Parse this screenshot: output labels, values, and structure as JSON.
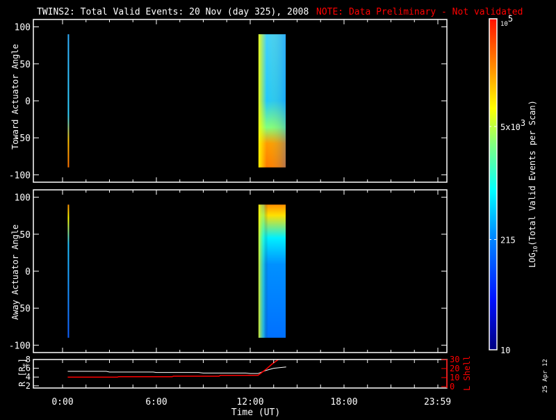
{
  "title": "TWINS2: Total Valid Events: 20 Nov (day 325), 2008",
  "note": "NOTE: Data Preliminary - Not validated",
  "datestamp": "25 Apr 12",
  "colors": {
    "background": "#000000",
    "axes": "#ffffff",
    "note": "#ff0000",
    "lshell": "#ff0000",
    "r": "#ffffff"
  },
  "chart_data": [
    {
      "type": "heatmap",
      "ylabel": "Toward Actuator Angle",
      "ylim": [
        -110,
        110
      ],
      "yticks": [
        "100",
        "50",
        "0",
        "-50",
        "-100"
      ],
      "xlim_hours": [
        0,
        24
      ],
      "intervals": [
        {
          "start_h": 0.33,
          "end_h": 0.42,
          "angle_range": [
            -90,
            90
          ],
          "description_colors": [
            "#ff7000",
            "#30c0ff",
            "#30c0ff",
            "#20a0ff"
          ]
        },
        {
          "start_h": 12.53,
          "end_h": 14.27,
          "angle_range": [
            -90,
            90
          ]
        }
      ]
    },
    {
      "type": "heatmap",
      "ylabel": "Away Actuator Angle",
      "ylim": [
        -110,
        110
      ],
      "yticks": [
        "100",
        "50",
        "0",
        "-50",
        "-100"
      ],
      "xlim_hours": [
        0,
        24
      ],
      "intervals": [
        {
          "start_h": 0.33,
          "end_h": 0.42,
          "angle_range": [
            -90,
            90
          ]
        },
        {
          "start_h": 12.53,
          "end_h": 14.27,
          "angle_range": [
            -90,
            90
          ]
        }
      ]
    },
    {
      "type": "line",
      "ylabel": "R [R",
      "ylabel_sub": "E",
      "ylim": [
        1.5,
        8
      ],
      "yticks": [
        "8",
        "6",
        "4",
        "2"
      ],
      "y2label": "L Shell",
      "y2lim": [
        0,
        30
      ],
      "y2ticks": [
        "30",
        "20",
        "10",
        "0"
      ],
      "xlabel": "Time (UT)",
      "xticks": [
        "0:00",
        "6:00",
        "12:00",
        "18:00",
        "23:59"
      ],
      "series": [
        {
          "axis": "left",
          "color": "#ffffff",
          "x": [
            0.33,
            2.8,
            3.0,
            5.8,
            6.0,
            8.7,
            9.0,
            11.7,
            12.0,
            12.5,
            13.0,
            13.5,
            14.3
          ],
          "y": [
            5.3,
            5.3,
            5.15,
            5.15,
            5.05,
            5.05,
            4.9,
            4.9,
            4.8,
            4.8,
            5.5,
            6.0,
            6.3
          ]
        },
        {
          "axis": "right",
          "color": "#ff0000",
          "x": [
            0.33,
            3.5,
            3.6,
            7.0,
            7.1,
            10.0,
            10.1,
            12.5,
            13.0,
            13.4,
            13.8
          ],
          "y": [
            10.5,
            10.5,
            11,
            11,
            11.5,
            11.5,
            12.5,
            12.5,
            19,
            25,
            30
          ]
        }
      ]
    }
  ],
  "colorbar": {
    "label": "LOG",
    "label_sub": "10",
    "label_rest": "(Total Valid Events per Scan)",
    "ticks": [
      {
        "base": "10",
        "exp": "5"
      },
      {
        "base": "5x10",
        "exp": "3"
      },
      {
        "base": "215",
        "exp": ""
      },
      {
        "base": "10",
        "exp": ""
      }
    ],
    "range": [
      10,
      100000
    ],
    "scale": "log"
  }
}
